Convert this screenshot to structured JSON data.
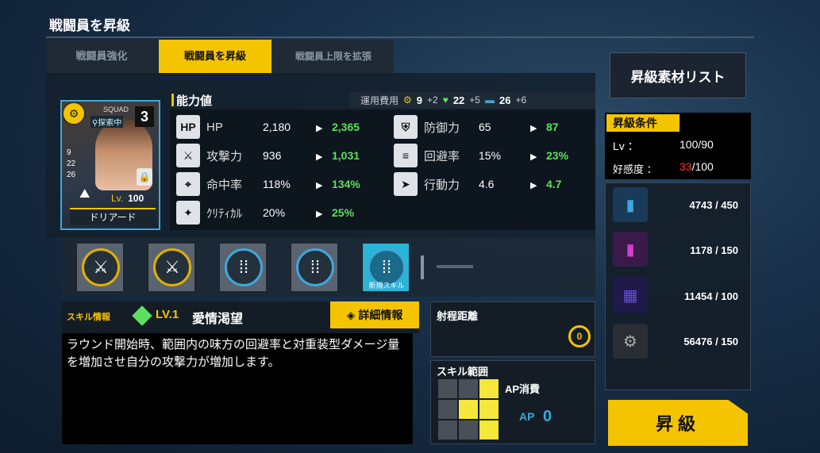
{
  "header": {
    "title": "戦闘員を昇級"
  },
  "tabs": [
    {
      "label": "戦闘員強化"
    },
    {
      "label": "戦闘員を昇級"
    },
    {
      "label": "戦闘員上限を拡張"
    }
  ],
  "card": {
    "squad_label": "SQUAD",
    "squad_number": "3",
    "status": "探索中",
    "stats": [
      "9",
      "22",
      "26"
    ],
    "level_label": "Lv.",
    "level": "100",
    "name": "ドリアード"
  },
  "abilities": {
    "title": "能力値",
    "cost_label": "運用費用",
    "costs": [
      {
        "value": "9",
        "plus": "+2",
        "icon": "gear-icon"
      },
      {
        "value": "22",
        "plus": "+5",
        "icon": "heart-icon"
      },
      {
        "value": "26",
        "plus": "+6",
        "icon": "battery-icon"
      }
    ],
    "stats": [
      {
        "icon": "HP",
        "name": "HP",
        "value": "2,180",
        "new": "2,365"
      },
      {
        "icon": "⚔",
        "name": "攻撃力",
        "value": "936",
        "new": "1,031"
      },
      {
        "icon": "⌖",
        "name": "命中率",
        "value": "118%",
        "new": "134%"
      },
      {
        "icon": "✦",
        "name": "ｸﾘﾃｨｶﾙ",
        "value": "20%",
        "new": "25%"
      },
      {
        "icon": "⛨",
        "name": "防御力",
        "value": "65",
        "new": "87"
      },
      {
        "icon": "≡",
        "name": "回避率",
        "value": "15%",
        "new": "23%"
      },
      {
        "icon": "➤",
        "name": "行動力",
        "value": "4.6",
        "new": "4.7"
      }
    ]
  },
  "skills": [
    {
      "icon": "sword-icon",
      "label": ""
    },
    {
      "icon": "sword-icon",
      "label": ""
    },
    {
      "icon": "bullets-icon",
      "label": ""
    },
    {
      "icon": "bullets-icon",
      "label": ""
    },
    {
      "icon": "bullets-icon",
      "label": "新規スキル"
    }
  ],
  "skill_info": {
    "label": "スキル情報",
    "level": "LV.1",
    "name": "愛情渇望",
    "detail_button": "詳細情報",
    "description": "ラウンド開始時、範囲内の味方の回避率と対重装型ダメージ量を増加させ自分の攻撃力が増加します。",
    "range_label": "射程距離",
    "range_value": "0",
    "area_label": "スキル範囲",
    "area_grid": [
      0,
      0,
      1,
      0,
      1,
      1,
      0,
      0,
      1
    ],
    "ap_label": "AP消費",
    "ap_short": "AP",
    "ap_value": "0"
  },
  "materials": {
    "button": "昇級素材リスト",
    "condition_title": "昇級条件",
    "lv_label": "Lv ：",
    "lv_value": "100/90",
    "affection_label": "好感度 ：",
    "affection_current": "33",
    "affection_max": "/100",
    "items": [
      {
        "icon": "chip-blue-icon",
        "count": "4743 / 450",
        "color": "#3ea8d8"
      },
      {
        "icon": "chip-pink-icon",
        "count": "1178 / 150",
        "color": "#d040c8"
      },
      {
        "icon": "module-icon",
        "count": "11454 / 100",
        "color": "#6a4ad8"
      },
      {
        "icon": "part-icon",
        "count": "56476 / 150",
        "color": "#8a8a8a"
      }
    ],
    "promote_button": "昇級"
  }
}
